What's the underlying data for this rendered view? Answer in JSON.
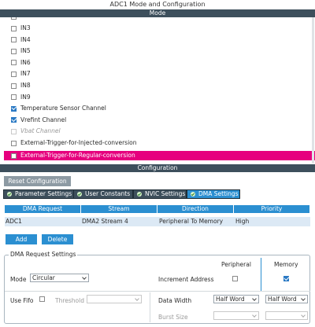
{
  "window": {
    "title": "ADC1 Mode and Configuration"
  },
  "mode_bar": "Mode",
  "channels": [
    {
      "label": "IN3",
      "checked": false,
      "disabled": false
    },
    {
      "label": "IN4",
      "checked": false,
      "disabled": false
    },
    {
      "label": "IN5",
      "checked": false,
      "disabled": false
    },
    {
      "label": "IN6",
      "checked": false,
      "disabled": false
    },
    {
      "label": "IN7",
      "checked": false,
      "disabled": false
    },
    {
      "label": "IN8",
      "checked": false,
      "disabled": false
    },
    {
      "label": "IN9",
      "checked": false,
      "disabled": false
    },
    {
      "label": "Temperature Sensor Channel",
      "checked": true,
      "disabled": false
    },
    {
      "label": "Vrefint Channel",
      "checked": true,
      "disabled": false
    },
    {
      "label": "Vbat Channel",
      "checked": false,
      "disabled": true
    },
    {
      "label": "External-Trigger-for-Injected-conversion",
      "checked": false,
      "disabled": false
    }
  ],
  "highlighted_item": {
    "label": "External-Trigger-for-Regular-conversion",
    "checked": false,
    "color": "#e6007e"
  },
  "config_bar": "Configuration",
  "reset_button": "Reset Configuration",
  "tabs": [
    {
      "label": "Parameter Settings",
      "active": false
    },
    {
      "label": "User Constants",
      "active": false
    },
    {
      "label": "NVIC Settings",
      "active": false
    },
    {
      "label": "DMA Settings",
      "active": true
    }
  ],
  "dma_table": {
    "headers": [
      "DMA Request",
      "Stream",
      "Direction",
      "Priority"
    ],
    "rows": [
      [
        "ADC1",
        "DMA2 Stream 4",
        "Peripheral To Memory",
        "High"
      ]
    ]
  },
  "buttons": {
    "add": "Add",
    "delete": "Delete"
  },
  "request_settings": {
    "legend": "DMA Request Settings",
    "peripheral_header": "Peripheral",
    "memory_header": "Memory",
    "mode_label": "Mode",
    "mode_value": "Circular",
    "increment_label": "Increment Address",
    "peripheral_increment": false,
    "memory_increment": true,
    "use_fifo_label": "Use Fifo",
    "threshold_label": "Threshold",
    "threshold_value": "",
    "data_width_label": "Data Width",
    "peripheral_data_width": "Half Word",
    "memory_data_width": "Half Word",
    "burst_size_label": "Burst Size",
    "peripheral_burst": "",
    "memory_burst": ""
  },
  "colors": {
    "accent": "#2b8fd1",
    "header_bar": "#3d4f5c",
    "highlight": "#e6007e"
  }
}
